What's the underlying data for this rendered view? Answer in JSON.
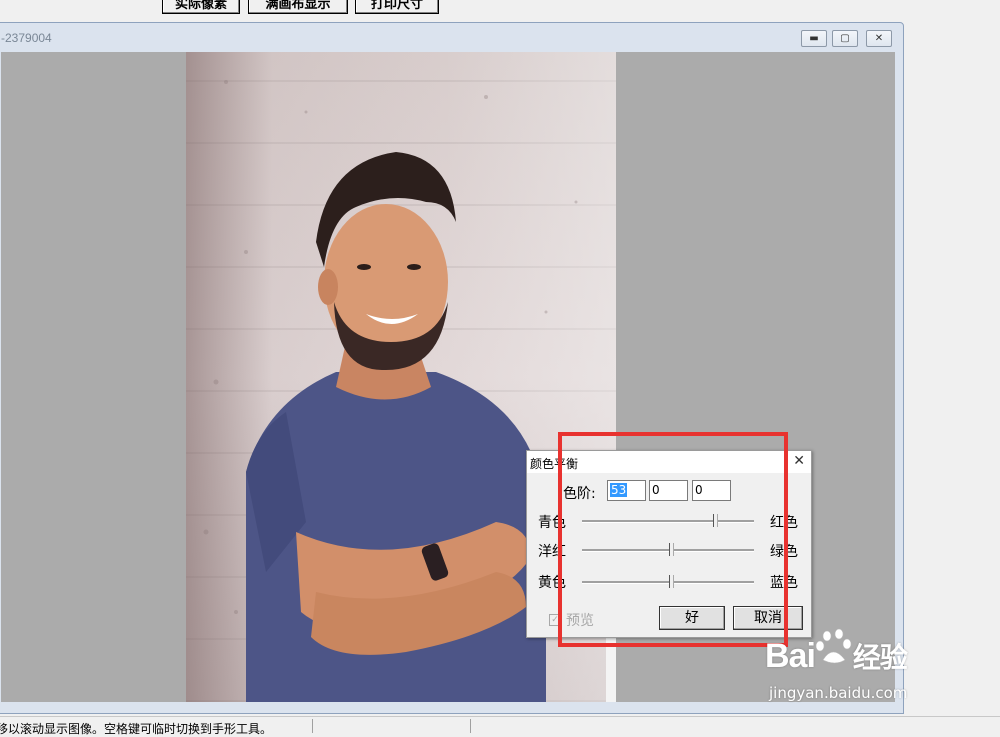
{
  "toolbar": {
    "buttons": [
      "实际像素",
      "满画布显示",
      "打印尺寸"
    ]
  },
  "document": {
    "title": "-2379004"
  },
  "dialog": {
    "title": "颜色平衡",
    "levels_label": "色阶:",
    "levels": [
      "53",
      "0",
      "0"
    ],
    "sliders": [
      {
        "left": "青色",
        "right": "红色",
        "value": 53
      },
      {
        "left": "洋红",
        "right": "绿色",
        "value": 0
      },
      {
        "left": "黄色",
        "right": "蓝色",
        "value": 0
      }
    ],
    "preview_label": "预览",
    "preview_checked": true,
    "ok_label": "好",
    "cancel_label": "取消"
  },
  "watermark": {
    "brand": "Bai",
    "brand_suffix": "经验",
    "url": "jingyan.baidu.com"
  },
  "statusbar": {
    "text": "移以滚动显示图像。空格键可临时切换到手形工具。"
  },
  "colors": {
    "highlight": "#e8322f",
    "selection": "#3399ff",
    "shirt": "#4d5587"
  }
}
